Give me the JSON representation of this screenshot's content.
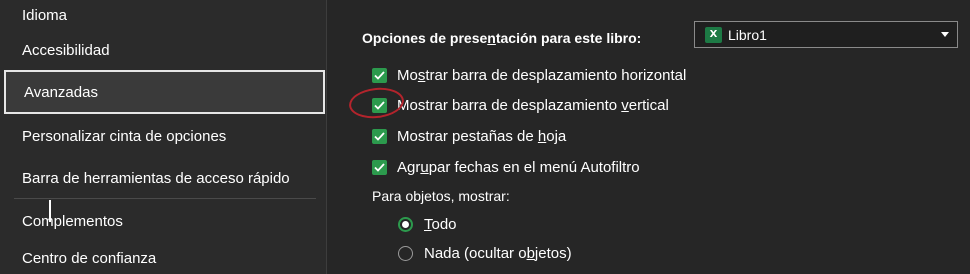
{
  "sidebar": {
    "items": [
      {
        "label": "Idioma"
      },
      {
        "label": "Accesibilidad"
      },
      {
        "label": "Avanzadas",
        "selected": true
      },
      {
        "label": "Personalizar cinta de opciones"
      },
      {
        "label": "Barra de herramientas de acceso rápido"
      },
      {
        "label": "Complementos"
      },
      {
        "label": "Centro de confianza"
      }
    ]
  },
  "display": {
    "label_pre": "Opciones de prese",
    "label_ul": "n",
    "label_post": "tación para este libro:",
    "book_icon_text": "X",
    "book_value": "Libro1",
    "options": [
      {
        "pre": "Mo",
        "ul": "s",
        "post": "trar barra de desplazamiento horizontal",
        "checked": true
      },
      {
        "pre": "Mostrar barra de desplazamiento ",
        "ul": "v",
        "post": "ertical",
        "checked": true
      },
      {
        "pre": "Mostrar pestañas de ",
        "ul": "h",
        "post": "oja",
        "checked": true
      },
      {
        "pre": "Agr",
        "ul": "u",
        "post": "par fechas en el menú Autofiltro",
        "checked": true
      }
    ],
    "objects_label": "Para objetos, mostrar:",
    "radios": [
      {
        "pre": "",
        "ul": "T",
        "post": "odo",
        "selected": true
      },
      {
        "pre": "Nada (ocultar o",
        "ul": "b",
        "post": "jetos)",
        "selected": false
      }
    ]
  },
  "colors": {
    "accent_green": "#2c9a4d",
    "annotation_red": "#b3242c",
    "excel_green": "#1d7a45"
  }
}
